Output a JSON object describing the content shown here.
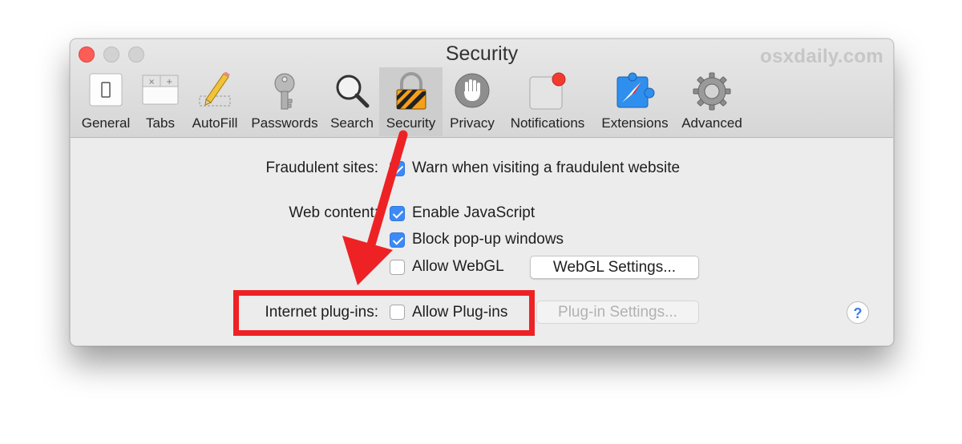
{
  "window": {
    "title": "Security",
    "watermark": "osxdaily.com",
    "accent": "#3d8af7",
    "annotation_color": "#ee2224"
  },
  "toolbar": {
    "tabs": [
      {
        "label": "General",
        "icon": "general-switch-icon"
      },
      {
        "label": "Tabs",
        "icon": "tabs-icon"
      },
      {
        "label": "AutoFill",
        "icon": "pencil-icon"
      },
      {
        "label": "Passwords",
        "icon": "key-icon"
      },
      {
        "label": "Search",
        "icon": "magnifier-icon"
      },
      {
        "label": "Security",
        "icon": "lock-icon",
        "selected": true
      },
      {
        "label": "Privacy",
        "icon": "hand-icon"
      },
      {
        "label": "Notifications",
        "icon": "notification-badge-icon"
      },
      {
        "label": "Extensions",
        "icon": "puzzle-compass-icon"
      },
      {
        "label": "Advanced",
        "icon": "gear-icon"
      }
    ]
  },
  "security": {
    "fraudulent": {
      "label": "Fraudulent sites:",
      "option": "Warn when visiting a fraudulent website",
      "checked": true
    },
    "web_content": {
      "label": "Web content:",
      "options": [
        {
          "label": "Enable JavaScript",
          "checked": true
        },
        {
          "label": "Block pop-up windows",
          "checked": true
        },
        {
          "label": "Allow WebGL",
          "checked": false
        }
      ],
      "webgl_button": "WebGL Settings..."
    },
    "plugins": {
      "label": "Internet plug-ins:",
      "option": "Allow Plug-ins",
      "checked": false,
      "button": "Plug-in Settings..."
    },
    "help": "?"
  }
}
